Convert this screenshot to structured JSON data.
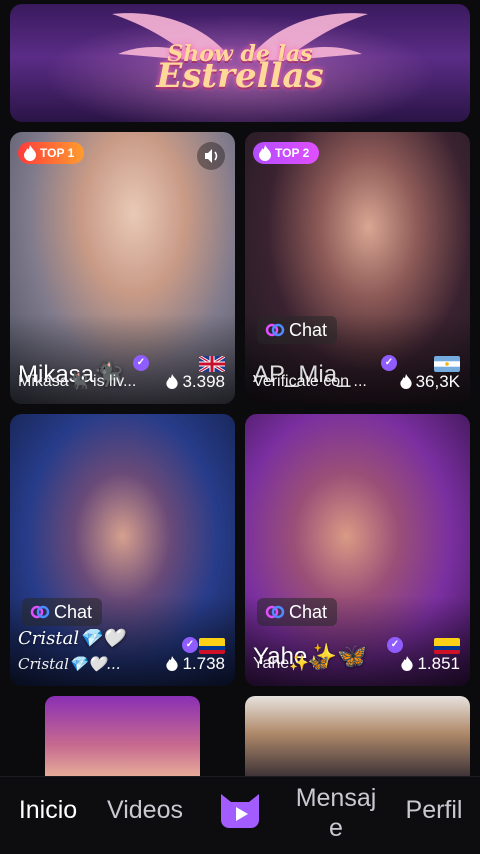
{
  "banner": {
    "line1": "Show de las",
    "line2": "Estrellas"
  },
  "cards": [
    {
      "rank_label": "TOP 1",
      "big_name": "Mikasa🐈‍⬛",
      "subtitle": "Mikasa🐈‍⬛ is liv...",
      "views": "3.398",
      "flag": "gb"
    },
    {
      "rank_label": "TOP 2",
      "chat_label": "Chat",
      "big_name": "AP_Mia_",
      "subtitle": "Verificate con ...",
      "views": "36,3K",
      "flag": "ar"
    },
    {
      "chat_label": "Chat",
      "big_name": "Cristal💎🤍",
      "subtitle": "Cristal💎🤍...",
      "views": "1.738",
      "flag": "co"
    },
    {
      "chat_label": "Chat",
      "big_name": "Yahe✨🦋",
      "subtitle": "Yahe✨🦋",
      "views": "1.851",
      "flag": "co"
    }
  ],
  "tabs": {
    "inicio": "Inicio",
    "videos": "Videos",
    "mensaje_1": "Mensaj",
    "mensaje_2": "e",
    "perfil": "Perfil"
  },
  "icons": [
    "sound-icon",
    "flame-icon",
    "chat-link-icon",
    "verified-icon",
    "cat-logo-icon"
  ],
  "colors": {
    "accent": "#a35cff",
    "top1": "#ff6a2e",
    "top2": "#c04dff"
  }
}
